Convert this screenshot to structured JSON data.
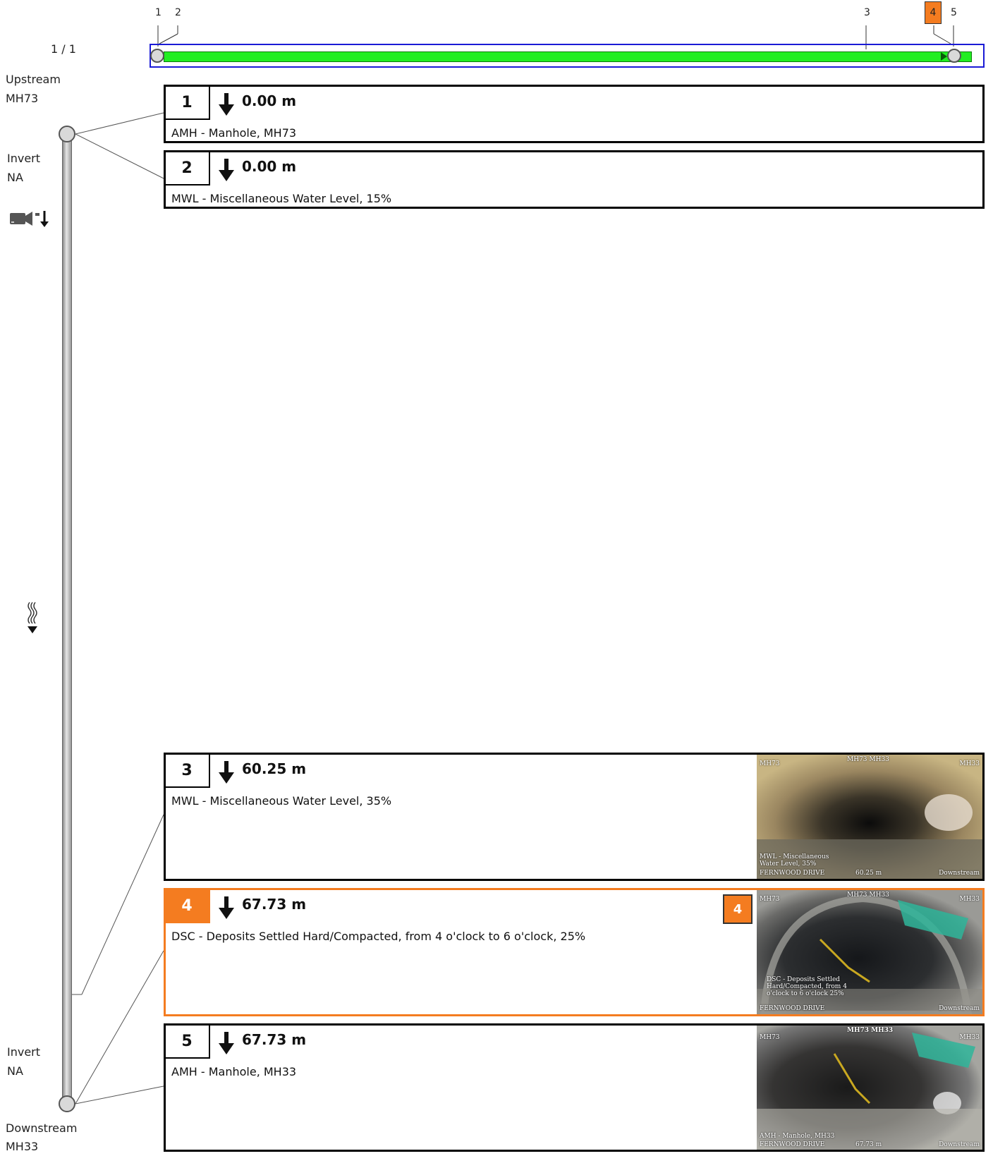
{
  "page_indicator": "1 / 1",
  "upstream": {
    "label": "Upstream",
    "node": "MH73"
  },
  "downstream": {
    "label": "Downstream",
    "node": "MH33"
  },
  "invert_top": {
    "label": "Invert",
    "value": "NA"
  },
  "invert_bottom": {
    "label": "Invert",
    "value": "NA"
  },
  "icons": {
    "camera": "camera-direction-icon",
    "flow": "flow-direction-icon",
    "arrow": "down-arrow-icon"
  },
  "colors": {
    "selected": "#f47c20",
    "overview_bar": "#22ee22",
    "overview_frame": "#1a1ad6"
  },
  "overview_markers": [
    "1",
    "2",
    "3",
    "4",
    "5"
  ],
  "events": [
    {
      "num": "1",
      "distance": "0.00 m",
      "description": "AMH - Manhole, MH73",
      "selected": false
    },
    {
      "num": "2",
      "distance": "0.00 m",
      "description": "MWL - Miscellaneous Water Level, 15%",
      "selected": false
    },
    {
      "num": "3",
      "distance": "60.25 m",
      "description": "MWL - Miscellaneous Water Level, 35%",
      "selected": false,
      "thumb": {
        "top": "MH73 MH33",
        "left": "MH73",
        "right": "MH33",
        "cap": "MWL - Miscellaneous Water Level, 35%",
        "dist": "60.25 m",
        "street": "FERNWOOD DRIVE",
        "dir": "Downstream"
      }
    },
    {
      "num": "4",
      "distance": "67.73 m",
      "description": "DSC - Deposits Settled Hard/Compacted, from 4 o'clock to 6 o'clock, 25%",
      "selected": true,
      "badge": "4",
      "thumb": {
        "top": "MH73 MH33",
        "left": "MH73",
        "right": "MH33",
        "cap": "DSC - Deposits Settled Hard/Compacted, from 4 o'clock to 6 o'clock 25%",
        "street": "FERNWOOD DRIVE",
        "dir": "Downstream"
      }
    },
    {
      "num": "5",
      "distance": "67.73 m",
      "description": "AMH - Manhole, MH33",
      "selected": false,
      "thumb": {
        "top": "MH73 MH33",
        "left": "MH73",
        "right": "MH33",
        "cap": "AMH - Manhole, MH33",
        "dist": "67.73 m",
        "street": "FERNWOOD DRIVE",
        "dir": "Downstream"
      }
    }
  ]
}
